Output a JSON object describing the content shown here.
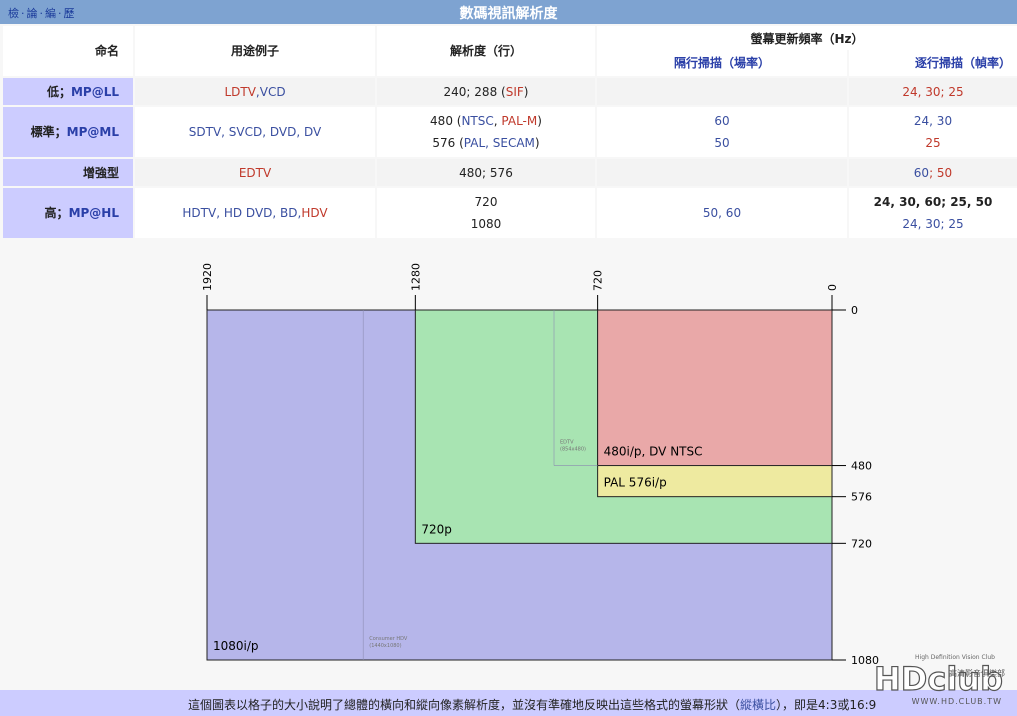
{
  "title": "數碼視訊解析度",
  "vnav": [
    "檢",
    "論",
    "編",
    "歷"
  ],
  "headers": {
    "name": "命名",
    "usage": "用途例子",
    "resolution": "解析度（行）",
    "refresh": "螢幕更新頻率（Hz）",
    "interlaced": "隔行掃描（場率）",
    "progressive": "逐行掃描（幀率）"
  },
  "rows": [
    {
      "name_prefix": "低；",
      "name_code": "MP@LL",
      "usage": [
        {
          "t": "LDTV",
          "c": "red"
        },
        {
          "t": ", ",
          "c": "blue"
        },
        {
          "t": "VCD",
          "c": "blue"
        }
      ],
      "res_lines": [
        [
          {
            "t": "240; 288 (",
            "c": "plain"
          },
          {
            "t": "SIF",
            "c": "red"
          },
          {
            "t": ")",
            "c": "plain"
          }
        ]
      ],
      "interlaced_lines": [],
      "progressive_lines": [
        [
          {
            "t": "24, 30; 25",
            "c": "red"
          }
        ]
      ]
    },
    {
      "name_prefix": "標準；",
      "name_code": "MP@ML",
      "usage": [
        {
          "t": "SDTV, SVCD, DVD, DV",
          "c": "blue"
        }
      ],
      "res_lines": [
        [
          {
            "t": "480 (",
            "c": "plain"
          },
          {
            "t": "NTSC",
            "c": "blue"
          },
          {
            "t": ", ",
            "c": "plain"
          },
          {
            "t": "PAL-M",
            "c": "red"
          },
          {
            "t": ")",
            "c": "plain"
          }
        ],
        [
          {
            "t": "576 (",
            "c": "plain"
          },
          {
            "t": "PAL, SECAM",
            "c": "blue"
          },
          {
            "t": ")",
            "c": "plain"
          }
        ]
      ],
      "interlaced_lines": [
        [
          {
            "t": "60",
            "c": "blue"
          }
        ],
        [
          {
            "t": "50",
            "c": "blue"
          }
        ]
      ],
      "progressive_lines": [
        [
          {
            "t": "24, 30",
            "c": "blue"
          }
        ],
        [
          {
            "t": "25",
            "c": "red"
          }
        ]
      ]
    },
    {
      "name_prefix": "增強型",
      "name_code": "",
      "usage": [
        {
          "t": "EDTV",
          "c": "red"
        }
      ],
      "res_lines": [
        [
          {
            "t": "480; 576",
            "c": "plain"
          }
        ]
      ],
      "interlaced_lines": [],
      "progressive_lines": [
        [
          {
            "t": "60",
            "c": "blue"
          },
          {
            "t": "; 50",
            "c": "red"
          }
        ]
      ]
    },
    {
      "name_prefix": "高；",
      "name_code": "MP@HL",
      "usage": [
        {
          "t": "HDTV, HD DVD, BD, ",
          "c": "blue"
        },
        {
          "t": "HDV",
          "c": "red"
        }
      ],
      "res_lines": [
        [
          {
            "t": "720",
            "c": "plain"
          }
        ],
        [
          {
            "t": "1080",
            "c": "plain"
          }
        ]
      ],
      "interlaced_lines": [
        [
          {
            "t": "",
            "c": "plain"
          }
        ],
        [
          {
            "t": "50, 60",
            "c": "blue"
          }
        ]
      ],
      "progressive_lines": [
        [
          {
            "t": "24, 30, 60; 25, 50",
            "c": "bold"
          }
        ],
        [
          {
            "t": "24, 30; 25",
            "c": "blue"
          }
        ]
      ]
    }
  ],
  "diagram": {
    "x_ticks": [
      "1920",
      "1280",
      "720",
      "0"
    ],
    "y_ticks": [
      "0",
      "480",
      "576",
      "720",
      "1080"
    ],
    "regions": [
      {
        "label": "1080i/p",
        "w": 1920,
        "h": 1080,
        "color": "#b6b6ea"
      },
      {
        "label": "720p",
        "w": 1280,
        "h": 720,
        "color": "#a8e4b2"
      },
      {
        "label": "PAL 576i/p",
        "w": 720,
        "h": 576,
        "color": "#eeeaa0"
      },
      {
        "label": "480i/p, DV NTSC",
        "w": 720,
        "h": 480,
        "color": "#e9a8a8"
      }
    ],
    "faint_1": {
      "w": 1440,
      "h": 1080,
      "label_line1": "Consumer HDV",
      "label_line2": "(1440x1080)"
    },
    "faint_2": {
      "w": 854,
      "h": 480,
      "label_line1": "EDTV",
      "label_line2": "(854x480)"
    }
  },
  "caption": {
    "before": "這個圖表以格子的大小說明了總體的橫向和縱向像素解析度，並沒有準確地反映出這些格式的螢幕形狀（",
    "link": "縱橫比",
    "after": "），即是4:3或16:9"
  },
  "logo": {
    "text": "HDclub",
    "tagline": "High Definition Vision Club",
    "url": "WWW.HD.CLUB.TW",
    "chinese": "高清影音俱樂部"
  }
}
